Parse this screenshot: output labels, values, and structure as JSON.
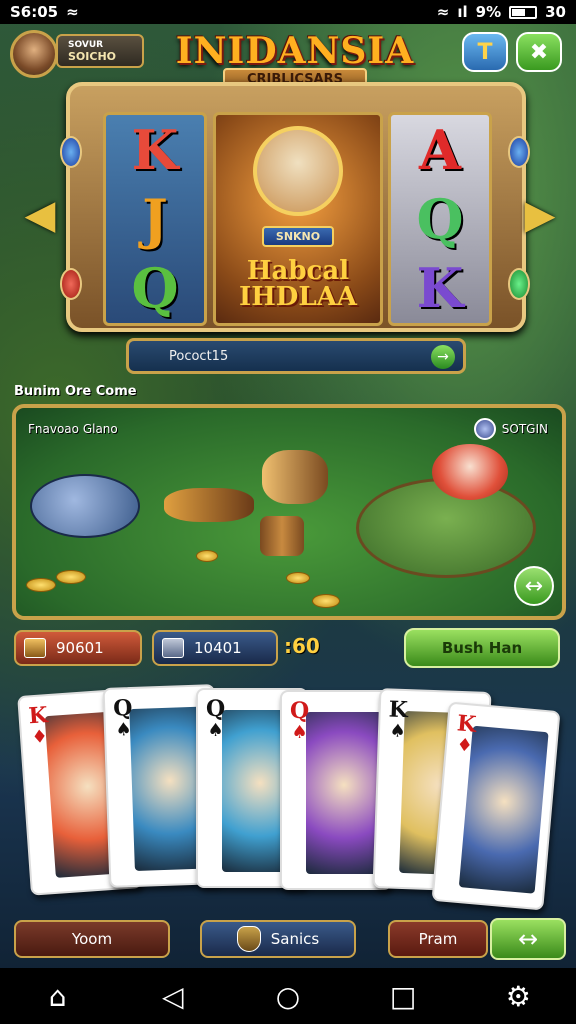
{
  "status_bar": {
    "time": "S6:05",
    "battery_text": "9%",
    "right_text": "30",
    "signal_text": "ıl"
  },
  "header": {
    "player_line1": "SOVUR",
    "player_line2": "SOICHO",
    "title": "INIDANSIA",
    "subtitle": "CRIBLICSARS",
    "blue_button_icon": "T",
    "green_button_icon": "✖"
  },
  "slot": {
    "reel1": [
      "K",
      "J",
      "Q"
    ],
    "reel2_tag": "SNKNO",
    "reel2_title_line1": "Habcal",
    "reel2_title_line2": "IHDLAA",
    "reel3": [
      "A",
      "Q",
      "K"
    ],
    "left_arrow": "◀",
    "right_arrow": "▶"
  },
  "promo": {
    "text": "Pococt15",
    "go_icon": "→"
  },
  "section_label": "Bunim Ore Come",
  "fish_panel": {
    "label": "Fnavoao Glano",
    "right_label": "SOTGIN",
    "go_icon": "↔"
  },
  "info": {
    "chest_value": "90601",
    "box_value": "10401",
    "timer": ":60",
    "action_label": "Bush Han"
  },
  "cards": [
    {
      "rank": "K",
      "suit": "♦",
      "color": "red",
      "art": "#e8603a"
    },
    {
      "rank": "Q",
      "suit": "♠",
      "color": "black",
      "art": "#3a8ac0"
    },
    {
      "rank": "Q",
      "suit": "♠",
      "color": "black",
      "art": "#40a0d0"
    },
    {
      "rank": "Q",
      "suit": "♠",
      "color": "red",
      "art": "#8a4ac0"
    },
    {
      "rank": "K",
      "suit": "♠",
      "color": "black",
      "art": "#e0c060"
    },
    {
      "rank": "K",
      "suit": "♦",
      "color": "red",
      "art": "#4a6ab0"
    }
  ],
  "bottom": {
    "btn1": "Yoom",
    "btn2": "Sanics",
    "btn3": "Pram",
    "go_icon": "↔"
  },
  "nav": {
    "home_icon": "⌂",
    "back_icon": "◁",
    "home_circle_icon": "○",
    "recents_icon": "□",
    "extra_icon": "⚙"
  }
}
